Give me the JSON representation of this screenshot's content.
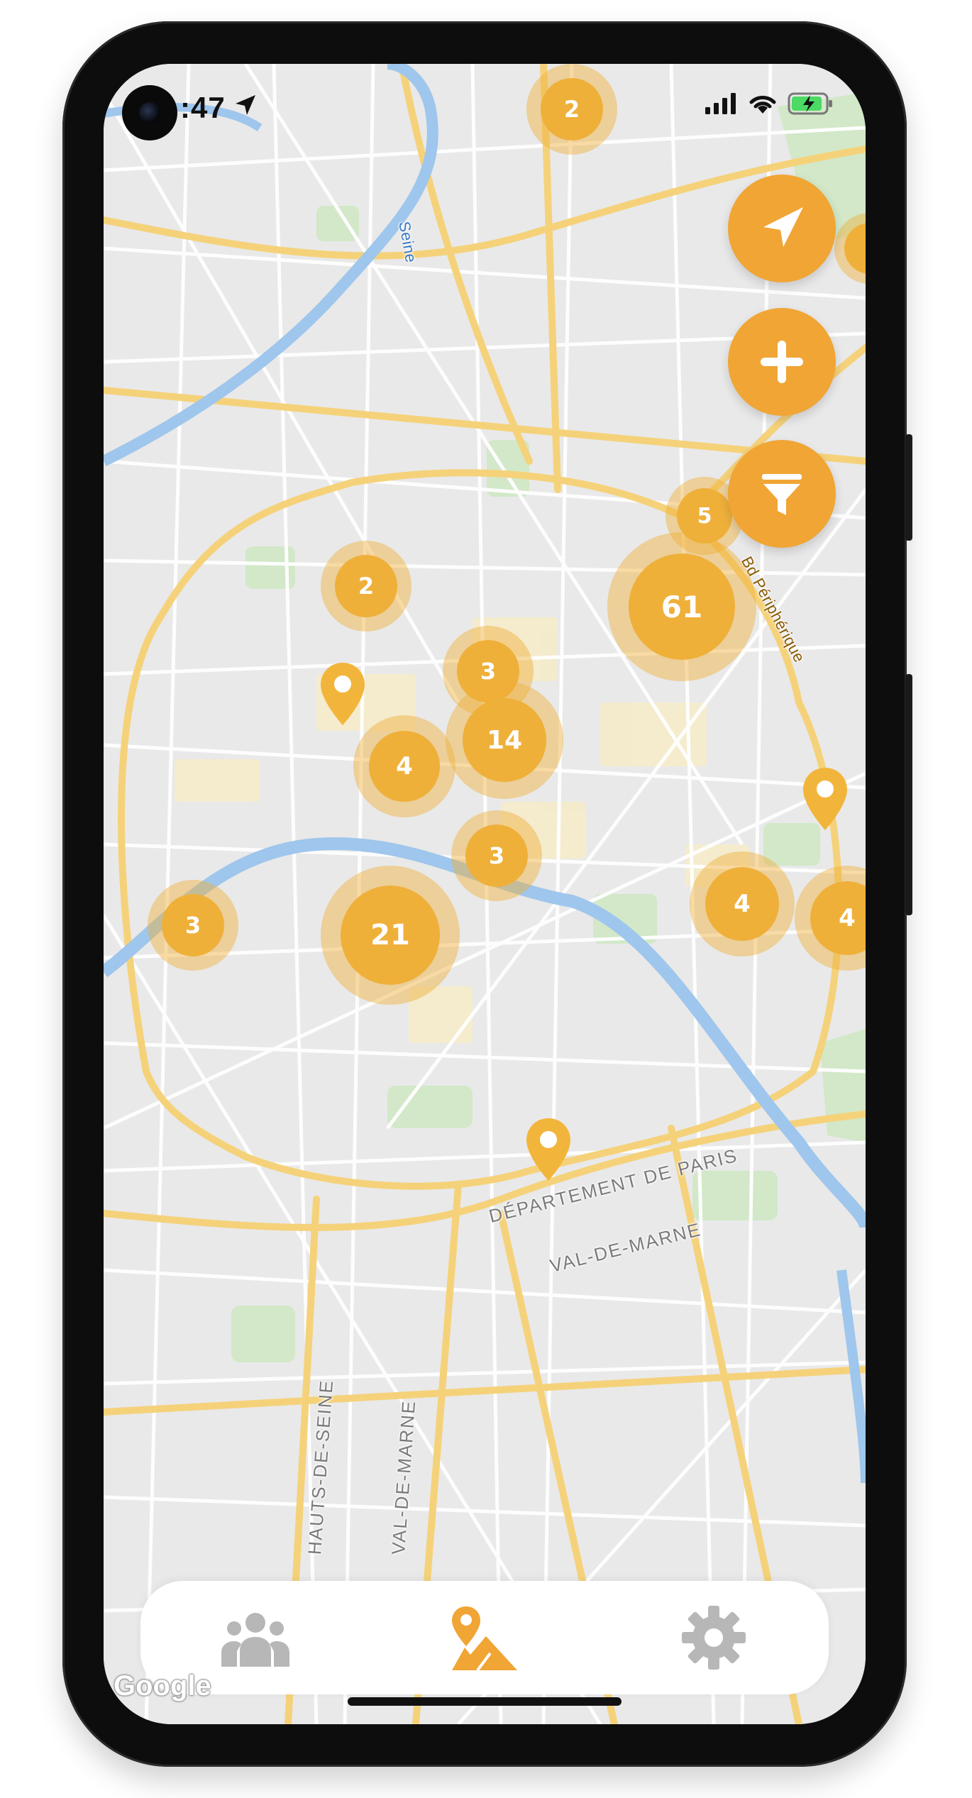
{
  "status_bar": {
    "time": ":47"
  },
  "map": {
    "labels": {
      "seine": "Seine",
      "bd_peripherique": "Bd Périphérique",
      "departement_paris": "DÉPARTEMENT DE PARIS",
      "val_de_marne_main": "VAL-DE-MARNE",
      "hauts_de_seine": "HAUTS-DE-SEINE",
      "val_de_marne_vertical": "VAL-DE-MARNE"
    },
    "clusters": [
      {
        "id": "top",
        "count": "2"
      },
      {
        "id": "nw",
        "count": "2"
      },
      {
        "id": "c3a",
        "count": "3"
      },
      {
        "id": "c14",
        "count": "14"
      },
      {
        "id": "c4a",
        "count": "4"
      },
      {
        "id": "c3b",
        "count": "3"
      },
      {
        "id": "c3w",
        "count": "3"
      },
      {
        "id": "c21",
        "count": "21"
      },
      {
        "id": "c61",
        "count": "61"
      },
      {
        "id": "c5",
        "count": "5"
      },
      {
        "id": "c4e",
        "count": "4"
      },
      {
        "id": "c4edge",
        "count": "4"
      }
    ],
    "attribution": "Google"
  },
  "controls": {
    "locate_icon": "navigation-arrow-icon",
    "zoom_in_icon": "plus-icon",
    "filter_icon": "filter-funnel-icon"
  },
  "bottom_nav": {
    "items": [
      {
        "icon": "group-users-icon",
        "active": false
      },
      {
        "icon": "map-pin-icon",
        "active": true
      },
      {
        "icon": "gear-icon",
        "active": false
      }
    ]
  },
  "colors": {
    "accent": "#f0a535",
    "cluster": "#efb03a",
    "inactive_icon": "#b7b7b7",
    "map_bg": "#e9e9e9",
    "major_road": "#f5d27a",
    "water": "#9fc6ec",
    "park": "#cfe8c4"
  }
}
